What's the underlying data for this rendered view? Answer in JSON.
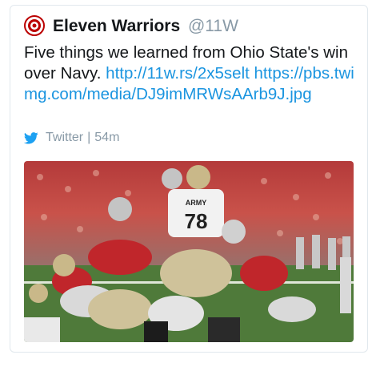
{
  "tweet": {
    "author_name": "Eleven Warriors",
    "author_handle": "@11W",
    "text": "Five things we learned from Ohio State's win over Navy.",
    "link_short": "http://11w.rs/2x5selt",
    "link_media": "https://pbs.twimg.com/media/DJ9imMRWsAArb9J.jpg",
    "source": "Twitter",
    "time": "54m"
  },
  "photo": {
    "jersey_text": "ARMY",
    "jersey_number": "78"
  },
  "colors": {
    "link": "#1b95e0",
    "twitter_blue": "#1da1f2",
    "scarlet": "#bb0000",
    "muted": "#8899a6"
  },
  "icons": {
    "avatar": "buckeye-logo-icon",
    "source": "twitter-bird-icon"
  }
}
